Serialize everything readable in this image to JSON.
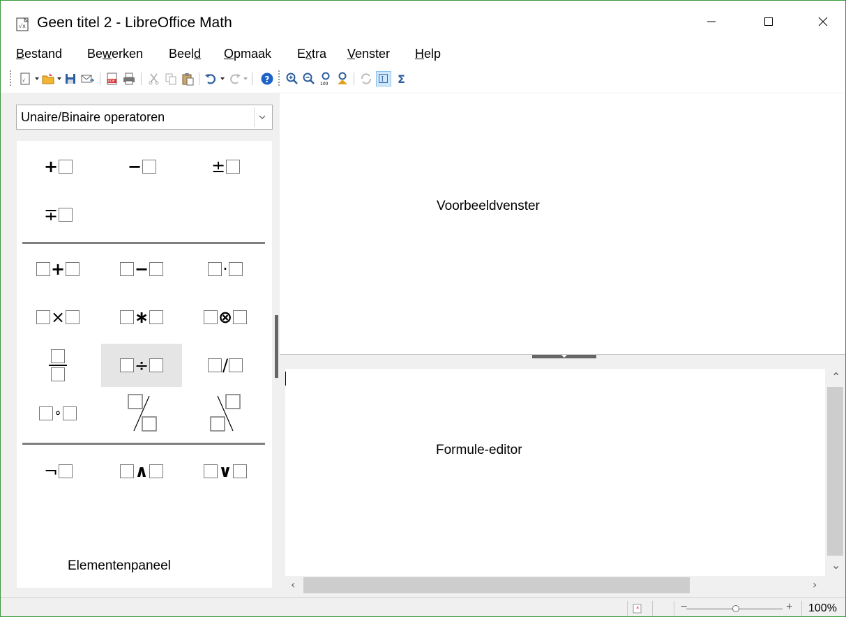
{
  "window": {
    "title": "Geen titel 2 - LibreOffice Math",
    "controls": {
      "minimize": "minimize",
      "maximize": "maximize",
      "close": "close"
    }
  },
  "menu": [
    {
      "label": "Bestand",
      "underline": "B"
    },
    {
      "label": "Bewerken",
      "underline": "w"
    },
    {
      "label": "Beeld",
      "underline": "d"
    },
    {
      "label": "Opmaak",
      "underline": "O"
    },
    {
      "label": "Extra",
      "underline": "x"
    },
    {
      "label": "Venster",
      "underline": "V"
    },
    {
      "label": "Help",
      "underline": "H"
    }
  ],
  "toolbar": {
    "icons": [
      "new-icon",
      "open-icon",
      "save-icon",
      "email-icon",
      "export-pdf-icon",
      "print-icon",
      "cut-icon",
      "copy-icon",
      "paste-icon",
      "undo-icon",
      "redo-icon",
      "help-icon",
      "zoom-in-icon",
      "zoom-out-icon",
      "zoom-100-icon",
      "show-all-icon",
      "update-icon",
      "formula-cursor-icon",
      "symbols-icon"
    ]
  },
  "elements_panel": {
    "category": "Unaire/Binaire operatoren",
    "caption": "Elementenpaneel",
    "unary": [
      "+",
      "−",
      "±",
      "∓"
    ],
    "binary": [
      "+",
      "−",
      "·",
      "×",
      "∗",
      "⊗",
      "fraction",
      "÷",
      "/",
      "∘",
      "wideslash",
      "widebslash"
    ],
    "logic": [
      "¬",
      "∧",
      "∨"
    ]
  },
  "preview": {
    "caption": "Voorbeeldvenster"
  },
  "editor": {
    "caption": "Formule-editor",
    "content": ""
  },
  "statusbar": {
    "zoom": "100%",
    "zoom_minus": "−",
    "zoom_plus": "+"
  },
  "colors": {
    "window_border": "#3c9a3c",
    "toolbar_active": "#cfe8fc",
    "help_blue": "#1e64c8"
  }
}
